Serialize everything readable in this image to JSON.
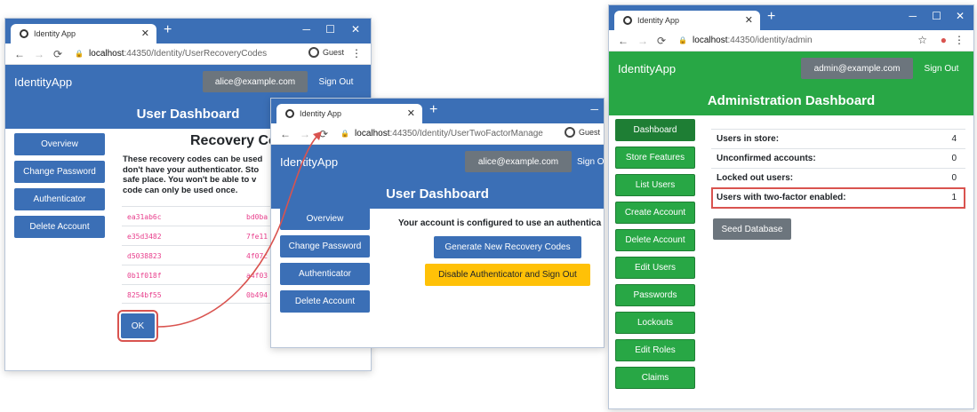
{
  "colors": {
    "primary": "#3b6fb6",
    "success": "#28a745",
    "secondary": "#6c757d",
    "warning": "#ffc107",
    "highlight": "#d9534f",
    "code": "#e83e8c"
  },
  "win1": {
    "tab_title": "Identity App",
    "url_host": "localhost",
    "url_path": ":44350/Identity/UserRecoveryCodes",
    "guest_label": "Guest",
    "brand": "IdentityApp",
    "user_email": "alice@example.com",
    "sign_out": "Sign Out",
    "banner": "User Dashboard",
    "sidebar": [
      "Overview",
      "Change Password",
      "Authenticator",
      "Delete Account"
    ],
    "title": "Recovery Co",
    "desc_lines": [
      "These recovery codes can be used",
      "don't have your authenticator. Sto",
      "safe place. You won't be able to v",
      "code can only be used once."
    ],
    "codes_left": [
      "ea31ab6c",
      "e35d3482",
      "d5038823",
      "0b1f018f",
      "8254bf55"
    ],
    "codes_right": [
      "bd0ba",
      "7fe11",
      "4f07c",
      "a4f03",
      "0b494"
    ],
    "ok": "OK"
  },
  "win2": {
    "tab_title": "Identity App",
    "url_host": "localhost",
    "url_path": ":44350/Identity/UserTwoFactorManage",
    "guest_label": "Guest",
    "brand": "IdentityApp",
    "user_email": "alice@example.com",
    "sign_out": "Sign O",
    "banner": "User Dashboard",
    "sidebar": [
      "Overview",
      "Change Password",
      "Authenticator",
      "Delete Account"
    ],
    "message": "Your account is configured to use an authentica",
    "generate": "Generate New Recovery Codes",
    "disable": "Disable Authenticator and Sign Out"
  },
  "win3": {
    "tab_title": "Identity App",
    "url_host": "localhost",
    "url_path": ":44350/identity/admin",
    "brand": "IdentityApp",
    "user_email": "admin@example.com",
    "sign_out": "Sign Out",
    "banner": "Administration Dashboard",
    "sidebar": [
      "Dashboard",
      "Store Features",
      "List Users",
      "Create Account",
      "Delete Account",
      "Edit Users",
      "Passwords",
      "Lockouts",
      "Edit Roles",
      "Claims"
    ],
    "stats": [
      {
        "label": "Users in store:",
        "value": "4"
      },
      {
        "label": "Unconfirmed accounts:",
        "value": "0"
      },
      {
        "label": "Locked out users:",
        "value": "0"
      },
      {
        "label": "Users with two-factor enabled:",
        "value": "1"
      }
    ],
    "seed": "Seed Database"
  }
}
